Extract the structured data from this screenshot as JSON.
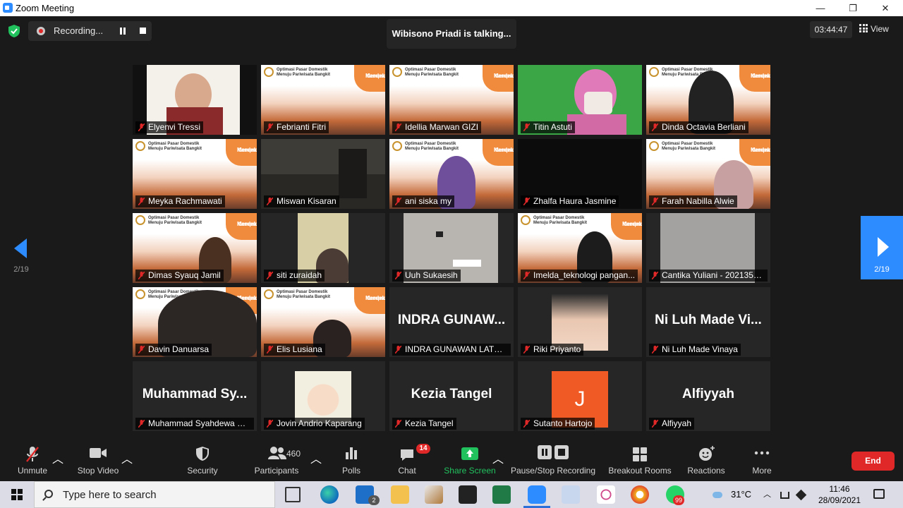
{
  "window": {
    "title": "Zoom Meeting",
    "minimize": "—",
    "maximize": "❐",
    "close": "✕"
  },
  "header": {
    "recording_label": "Recording...",
    "talking_text": "Wibisono Priadi is talking...",
    "timer": "03:44:47",
    "view_label": "View"
  },
  "banner": {
    "title_line1": "Optimasi Pasar Domestik",
    "title_line2": "Menuju Pariwisata Bangkit",
    "badge_line1": "Kampus",
    "badge_line2": "Merdeka"
  },
  "pagination": {
    "prev_page": "2/19",
    "next_page": "2/19"
  },
  "participants": [
    {
      "name": "Elyenvi Tressi",
      "kind": "video"
    },
    {
      "name": "Febrianti Fitri",
      "kind": "banner"
    },
    {
      "name": "Idellia Marwan GIZI",
      "kind": "banner"
    },
    {
      "name": "Titin Astuti",
      "kind": "video"
    },
    {
      "name": "Dinda Octavia Berliani",
      "kind": "banner"
    },
    {
      "name": "Meyka Rachmawati",
      "kind": "banner"
    },
    {
      "name": "Miswan Kisaran",
      "kind": "video"
    },
    {
      "name": "ani siska my",
      "kind": "banner"
    },
    {
      "name": "Zhalfa Haura Jasmine",
      "kind": "black"
    },
    {
      "name": "Farah Nabilla Alwie",
      "kind": "banner"
    },
    {
      "name": "Dimas Syauq Jamil",
      "kind": "banner"
    },
    {
      "name": "siti zuraidah",
      "kind": "video"
    },
    {
      "name": "Uuh Sukaesih",
      "kind": "video"
    },
    {
      "name": "Imelda_teknologi pangan...",
      "kind": "banner"
    },
    {
      "name": "Cantika Yuliani - 2021350...",
      "kind": "video"
    },
    {
      "name": "Davin Danuarsa",
      "kind": "banner"
    },
    {
      "name": "Elis Lusiana",
      "kind": "banner"
    },
    {
      "name": "INDRA GUNAWAN LATUR...",
      "kind": "text",
      "big": "INDRA GUNAW..."
    },
    {
      "name": "Riki Priyanto",
      "kind": "photo"
    },
    {
      "name": "Ni Luh Made Vinaya",
      "kind": "text",
      "big": "Ni Luh Made Vi..."
    },
    {
      "name": "Muhammad Syahdewa W...",
      "kind": "text",
      "big": "Muhammad Sy..."
    },
    {
      "name": "Jovin Andrio Kaparang",
      "kind": "photo"
    },
    {
      "name": "Kezia Tangel",
      "kind": "text",
      "big": "Kezia Tangel"
    },
    {
      "name": "Sutanto Hartojo",
      "kind": "avatar",
      "initial": "J"
    },
    {
      "name": "Alfiyyah",
      "kind": "text",
      "big": "Alfiyyah"
    }
  ],
  "toolbar": {
    "unmute": "Unmute",
    "stop_video": "Stop Video",
    "security": "Security",
    "participants": "Participants",
    "participants_count": "460",
    "polls": "Polls",
    "chat": "Chat",
    "chat_badge": "14",
    "share_screen": "Share Screen",
    "pause_stop_recording": "Pause/Stop Recording",
    "breakout_rooms": "Breakout Rooms",
    "reactions": "Reactions",
    "more": "More",
    "end": "End"
  },
  "taskbar": {
    "search_placeholder": "Type here to search",
    "mail_badge": "2",
    "whatsapp_badge": "99",
    "temperature": "31°C",
    "time": "11:46",
    "date": "28/09/2021"
  },
  "colors": {
    "accent": "#2d8cff",
    "end": "#e02828",
    "share": "#21c25e",
    "mute_red": "#e02828"
  }
}
